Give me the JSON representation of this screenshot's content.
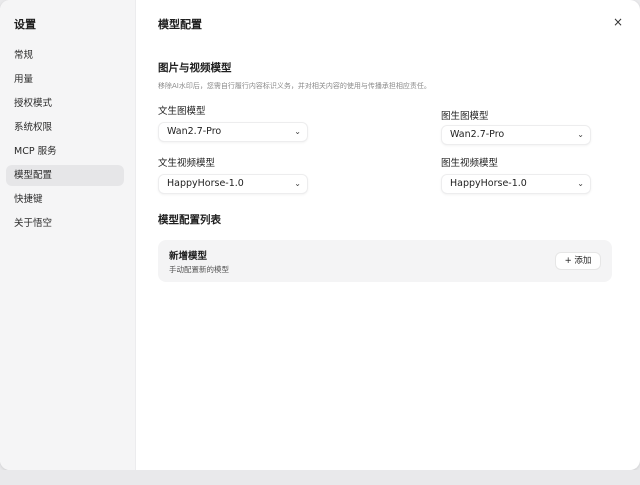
{
  "sidebar": {
    "title": "设置",
    "items": [
      {
        "label": "常规"
      },
      {
        "label": "用量"
      },
      {
        "label": "授权模式"
      },
      {
        "label": "系统权限"
      },
      {
        "label": "MCP 服务"
      },
      {
        "label": "模型配置",
        "active": true
      },
      {
        "label": "快捷键"
      },
      {
        "label": "关于悟空"
      }
    ]
  },
  "header": {
    "title": "模型配置",
    "close_icon": "×"
  },
  "section_media": {
    "title": "图片与视频模型",
    "notice": "移除AI水印后，您需自行履行内容标识义务，并对相关内容的使用与传播承担相应责任。",
    "fields": {
      "text_to_image": {
        "label": "文生图模型",
        "value": "Wan2.7-Pro"
      },
      "image_to_image": {
        "label": "图生图模型",
        "value": "Wan2.7-Pro"
      },
      "text_to_video": {
        "label": "文生视频模型",
        "value": "HappyHorse-1.0"
      },
      "image_to_video": {
        "label": "图生视频模型",
        "value": "HappyHorse-1.0"
      }
    },
    "chevron": "⌄"
  },
  "section_list": {
    "title": "模型配置列表",
    "card": {
      "title": "新增模型",
      "subtitle": "手动配置新的模型",
      "add_label": "+ 添加"
    }
  },
  "colors": {
    "sidebar_bg": "#f5f5f6",
    "active_item_bg": "#e6e6e8",
    "card_bg": "#f4f4f5",
    "text": "#1f1f1f"
  }
}
